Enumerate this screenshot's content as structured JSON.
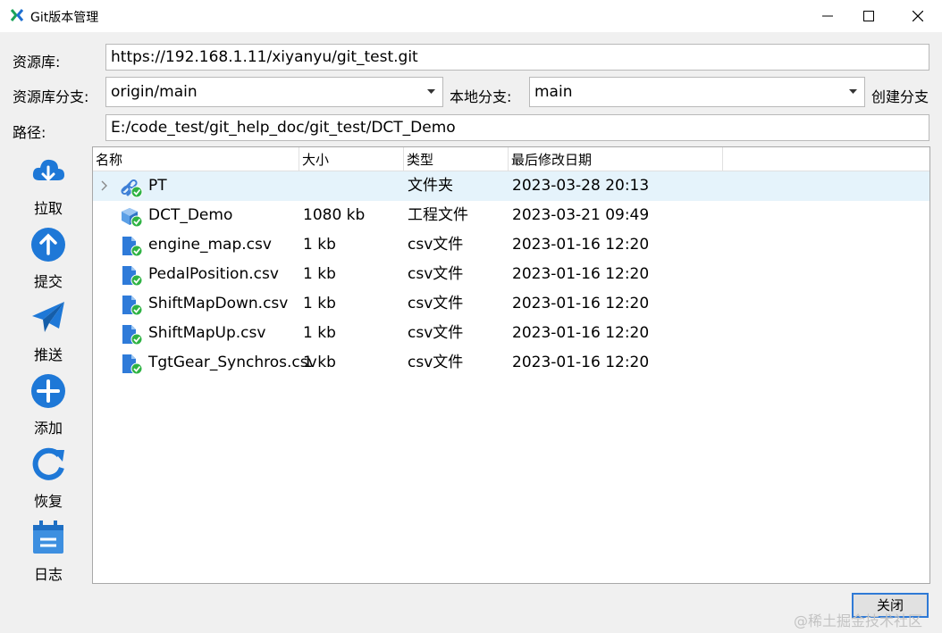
{
  "window": {
    "title": "Git版本管理",
    "controls": [
      "minimize",
      "maximize",
      "close"
    ]
  },
  "form": {
    "repo_label": "资源库:",
    "repo_url": "https://192.168.1.11/xiyanyu/git_test.git",
    "remote_branch_label": "资源库分支:",
    "remote_branch_value": "origin/main",
    "local_branch_label": "本地分支:",
    "local_branch_value": "main",
    "create_branch_label": "创建分支",
    "path_label": "路径:",
    "path_value": "E:/code_test/git_help_doc/git_test/DCT_Demo"
  },
  "sidebar": {
    "items": [
      {
        "label": "拉取",
        "icon": "cloud-download-icon"
      },
      {
        "label": "提交",
        "icon": "upload-arrow-icon"
      },
      {
        "label": "推送",
        "icon": "paper-plane-icon"
      },
      {
        "label": "添加",
        "icon": "add-icon"
      },
      {
        "label": "恢复",
        "icon": "refresh-icon"
      },
      {
        "label": "日志",
        "icon": "log-icon"
      }
    ]
  },
  "filelist": {
    "columns": [
      "名称",
      "大小",
      "类型",
      "最后修改日期"
    ],
    "rows": [
      {
        "name": "PT",
        "size": "",
        "type": "文件夹",
        "modified": "2023-03-28 20:13",
        "icon": "folder-link-icon",
        "selected": true,
        "expandable": true
      },
      {
        "name": "DCT_Demo",
        "size": "1080 kb",
        "type": "工程文件",
        "modified": "2023-03-21 09:49",
        "icon": "project-cube-icon",
        "selected": false,
        "expandable": false
      },
      {
        "name": "engine_map.csv",
        "size": "1 kb",
        "type": "csv文件",
        "modified": "2023-01-16 12:20",
        "icon": "file-check-icon",
        "selected": false,
        "expandable": false
      },
      {
        "name": "PedalPosition.csv",
        "size": "1 kb",
        "type": "csv文件",
        "modified": "2023-01-16 12:20",
        "icon": "file-check-icon",
        "selected": false,
        "expandable": false
      },
      {
        "name": "ShiftMapDown.csv",
        "size": "1 kb",
        "type": "csv文件",
        "modified": "2023-01-16 12:20",
        "icon": "file-check-icon",
        "selected": false,
        "expandable": false
      },
      {
        "name": "ShiftMapUp.csv",
        "size": "1 kb",
        "type": "csv文件",
        "modified": "2023-01-16 12:20",
        "icon": "file-check-icon",
        "selected": false,
        "expandable": false
      },
      {
        "name": "TgtGear_Synchros.csv",
        "size": "1 kb",
        "type": "csv文件",
        "modified": "2023-01-16 12:20",
        "icon": "file-check-icon",
        "selected": false,
        "expandable": false
      }
    ]
  },
  "footer": {
    "close_label": "关闭",
    "watermark": "@稀土掘金技术社区"
  },
  "colors": {
    "accent_blue": "#1e78d7",
    "check_green": "#2fb344",
    "selection": "#e5f3fb"
  }
}
